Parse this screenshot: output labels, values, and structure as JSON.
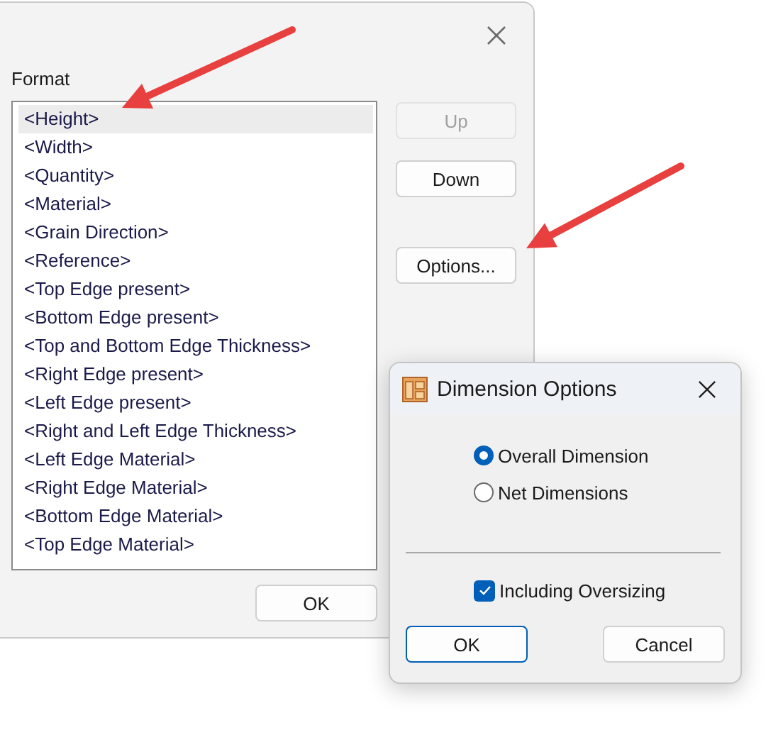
{
  "main_dialog": {
    "label": "Format",
    "items": [
      {
        "text": "<Height>",
        "selected": true
      },
      {
        "text": "<Width>",
        "selected": false
      },
      {
        "text": "<Quantity>",
        "selected": false
      },
      {
        "text": "<Material>",
        "selected": false
      },
      {
        "text": "<Grain Direction>",
        "selected": false
      },
      {
        "text": "<Reference>",
        "selected": false
      },
      {
        "text": "<Top Edge present>",
        "selected": false
      },
      {
        "text": "<Bottom Edge present>",
        "selected": false
      },
      {
        "text": "<Top and Bottom Edge Thickness>",
        "selected": false
      },
      {
        "text": "<Right Edge present>",
        "selected": false
      },
      {
        "text": "<Left Edge present>",
        "selected": false
      },
      {
        "text": "<Right and Left Edge Thickness>",
        "selected": false
      },
      {
        "text": "<Left Edge Material>",
        "selected": false
      },
      {
        "text": "<Right Edge Material>",
        "selected": false
      },
      {
        "text": "<Bottom Edge Material>",
        "selected": false
      },
      {
        "text": "<Top Edge Material>",
        "selected": false
      }
    ],
    "buttons": [
      {
        "label": "Up",
        "disabled": true
      },
      {
        "label": "Down",
        "disabled": false
      },
      {
        "label": "Options...",
        "disabled": false
      }
    ],
    "ok_button": "OK"
  },
  "options_dialog": {
    "title": "Dimension Options",
    "radios": [
      {
        "label": "Overall Dimension",
        "selected": true
      },
      {
        "label": "Net Dimensions",
        "selected": false
      }
    ],
    "checkbox": {
      "label": "Including Oversizing",
      "checked": true
    },
    "buttons": [
      {
        "label": "OK",
        "default": true
      },
      {
        "label": "Cancel",
        "default": false
      }
    ]
  }
}
